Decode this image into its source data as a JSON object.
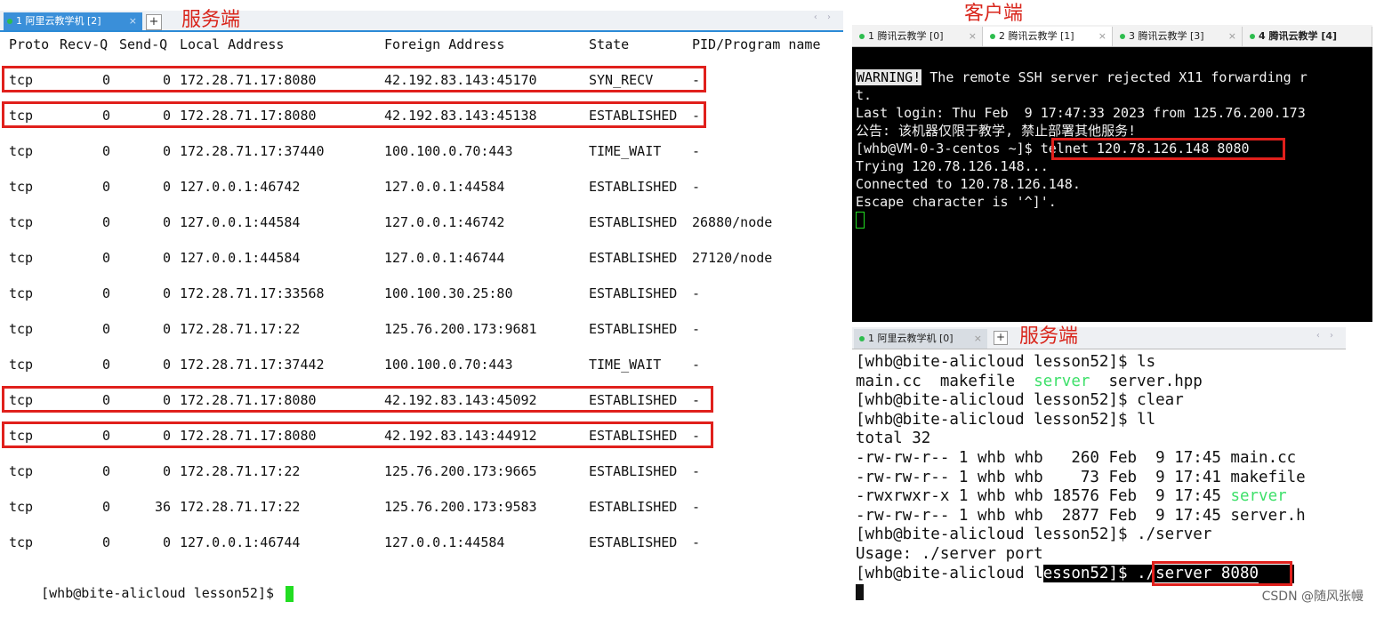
{
  "left_pane": {
    "tab_label": "1 阿里云教学机 [2]",
    "tab_close": "×",
    "tab_add": "+",
    "scroll_arrows": "‹ ›",
    "annotation": "服务端",
    "header": [
      "Proto",
      "Recv-Q",
      "Send-Q",
      "Local Address",
      "Foreign Address",
      "State",
      "PID/Program name"
    ],
    "rows": [
      {
        "proto": "tcp",
        "recvq": "0",
        "sendq": "0",
        "local": "172.28.71.17:8080",
        "foreign": "42.192.83.143:45170",
        "state": "SYN_RECV",
        "pid": "-",
        "highlight": true
      },
      {
        "proto": "tcp",
        "recvq": "0",
        "sendq": "0",
        "local": "172.28.71.17:8080",
        "foreign": "42.192.83.143:45138",
        "state": "ESTABLISHED",
        "pid": "-",
        "highlight": true
      },
      {
        "proto": "tcp",
        "recvq": "0",
        "sendq": "0",
        "local": "172.28.71.17:37440",
        "foreign": "100.100.0.70:443",
        "state": "TIME_WAIT",
        "pid": "-",
        "highlight": false
      },
      {
        "proto": "tcp",
        "recvq": "0",
        "sendq": "0",
        "local": "127.0.0.1:46742",
        "foreign": "127.0.0.1:44584",
        "state": "ESTABLISHED",
        "pid": "-",
        "highlight": false
      },
      {
        "proto": "tcp",
        "recvq": "0",
        "sendq": "0",
        "local": "127.0.0.1:44584",
        "foreign": "127.0.0.1:46742",
        "state": "ESTABLISHED",
        "pid": "26880/node",
        "highlight": false
      },
      {
        "proto": "tcp",
        "recvq": "0",
        "sendq": "0",
        "local": "127.0.0.1:44584",
        "foreign": "127.0.0.1:46744",
        "state": "ESTABLISHED",
        "pid": "27120/node",
        "highlight": false
      },
      {
        "proto": "tcp",
        "recvq": "0",
        "sendq": "0",
        "local": "172.28.71.17:33568",
        "foreign": "100.100.30.25:80",
        "state": "ESTABLISHED",
        "pid": "-",
        "highlight": false
      },
      {
        "proto": "tcp",
        "recvq": "0",
        "sendq": "0",
        "local": "172.28.71.17:22",
        "foreign": "125.76.200.173:9681",
        "state": "ESTABLISHED",
        "pid": "-",
        "highlight": false
      },
      {
        "proto": "tcp",
        "recvq": "0",
        "sendq": "0",
        "local": "172.28.71.17:37442",
        "foreign": "100.100.0.70:443",
        "state": "TIME_WAIT",
        "pid": "-",
        "highlight": false
      },
      {
        "proto": "tcp",
        "recvq": "0",
        "sendq": "0",
        "local": "172.28.71.17:8080",
        "foreign": "42.192.83.143:45092",
        "state": "ESTABLISHED",
        "pid": "-",
        "highlight": true
      },
      {
        "proto": "tcp",
        "recvq": "0",
        "sendq": "0",
        "local": "172.28.71.17:8080",
        "foreign": "42.192.83.143:44912",
        "state": "ESTABLISHED",
        "pid": "-",
        "highlight": true
      },
      {
        "proto": "tcp",
        "recvq": "0",
        "sendq": "0",
        "local": "172.28.71.17:22",
        "foreign": "125.76.200.173:9665",
        "state": "ESTABLISHED",
        "pid": "-",
        "highlight": false
      },
      {
        "proto": "tcp",
        "recvq": "0",
        "sendq": "36",
        "local": "172.28.71.17:22",
        "foreign": "125.76.200.173:9583",
        "state": "ESTABLISHED",
        "pid": "-",
        "highlight": false
      },
      {
        "proto": "tcp",
        "recvq": "0",
        "sendq": "0",
        "local": "127.0.0.1:46744",
        "foreign": "127.0.0.1:44584",
        "state": "ESTABLISHED",
        "pid": "-",
        "highlight": false
      }
    ],
    "prompt": "[whb@bite-alicloud lesson52]$ ",
    "colors": {
      "highlight_border": "#e0201c",
      "cursor": "#22dd22",
      "tab_active": "#3a8fd9"
    }
  },
  "client_pane": {
    "annotation": "客户端",
    "tabs": [
      {
        "label": "1 腾讯云教学 [0]",
        "close": "×"
      },
      {
        "label": "2 腾讯云教学 [1]",
        "close": "×"
      },
      {
        "label": "3 腾讯云教学 [3]",
        "close": "×"
      },
      {
        "label": "4 腾讯云教学 [4]",
        "close": ""
      }
    ],
    "warning_badge": "WARNING!",
    "lines": [
      " The remote SSH server rejected X11 forwarding r",
      "t.",
      "Last login: Thu Feb  9 17:47:33 2023 from 125.76.200.173",
      "公告: 该机器仅限于教学, 禁止部署其他服务!",
      "[whb@VM-0-3-centos ~]$ ",
      "telnet 120.78.126.148 8080",
      "Trying 120.78.126.148...",
      "Connected to 120.78.126.148.",
      "Escape character is '^]'."
    ]
  },
  "server_pane": {
    "annotation": "服务端",
    "tab_label": "1 阿里云教学机 [0]",
    "tab_close": "×",
    "tab_add": "+",
    "scroll_arrows": "‹ ›",
    "lines": {
      "l1": "[whb@bite-alicloud lesson52]$ ls",
      "l2a": "main.cc  makefile  ",
      "l2b": "server",
      "l2c": "  server.hpp",
      "l3": "[whb@bite-alicloud lesson52]$ clear",
      "l4": "[whb@bite-alicloud lesson52]$ ll",
      "l5": "total 32",
      "l6": "-rw-rw-r-- 1 whb whb   260 Feb  9 17:45 main.cc",
      "l7": "-rw-rw-r-- 1 whb whb    73 Feb  9 17:41 makefile",
      "l8a": "-rwxrwxr-x 1 whb whb 18576 Feb  9 17:45 ",
      "l8b": "server",
      "l9": "-rw-rw-r-- 1 whb whb  2877 Feb  9 17:45 server.h",
      "l10": "[whb@bite-alicloud lesson52]$ ./server",
      "l11": "Usage: ./server port",
      "l12a": "[whb@bite-alicloud l",
      "l12b": "esson52]$ ",
      "l12c": "./server 8080"
    }
  },
  "watermark": "CSDN @随风张幔"
}
